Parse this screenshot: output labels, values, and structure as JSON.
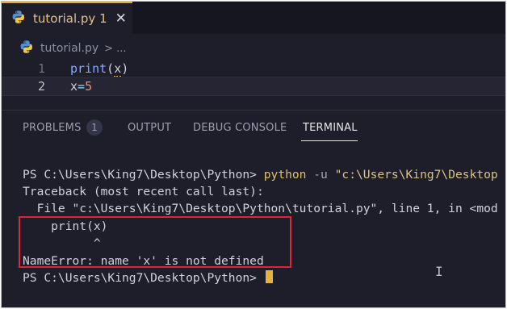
{
  "editor_tab": {
    "title": "tutorial.py 1",
    "close_icon": "close-icon",
    "file_icon": "python-icon",
    "accent_color": "#e6a93a",
    "title_color": "#e2c08d"
  },
  "breadcrumb": {
    "file": "tutorial.py",
    "separator": ">",
    "more": "..."
  },
  "editor": {
    "lines": [
      {
        "number": "1",
        "fn": "print",
        "open": "(",
        "var": "x",
        "close": ")"
      },
      {
        "number": "2",
        "name": "x",
        "op": "=",
        "value": "5"
      }
    ]
  },
  "panel": {
    "tabs": [
      {
        "label": "PROBLEMS",
        "badge": "1"
      },
      {
        "label": "OUTPUT"
      },
      {
        "label": "DEBUG CONSOLE"
      },
      {
        "label": "TERMINAL",
        "active": true
      }
    ]
  },
  "terminal": {
    "prompt": "PS C:\\Users\\King7\\Desktop\\Python>",
    "command": "python",
    "flag": "-u",
    "arg": "\"c:\\Users\\King7\\Desktop",
    "traceback_header": "Traceback (most recent call last):",
    "file_line": "  File \"c:\\Users\\King7\\Desktop\\Python\\tutorial.py\", line 1, in <mod",
    "code_line": "    print(x)",
    "caret_line": "          ^",
    "error": "NameError: name 'x' is not defined",
    "final_prompt": "PS C:\\Users\\King7\\Desktop\\Python>",
    "highlight_color": "#e02434",
    "cursor_color": "#e6b23a"
  }
}
